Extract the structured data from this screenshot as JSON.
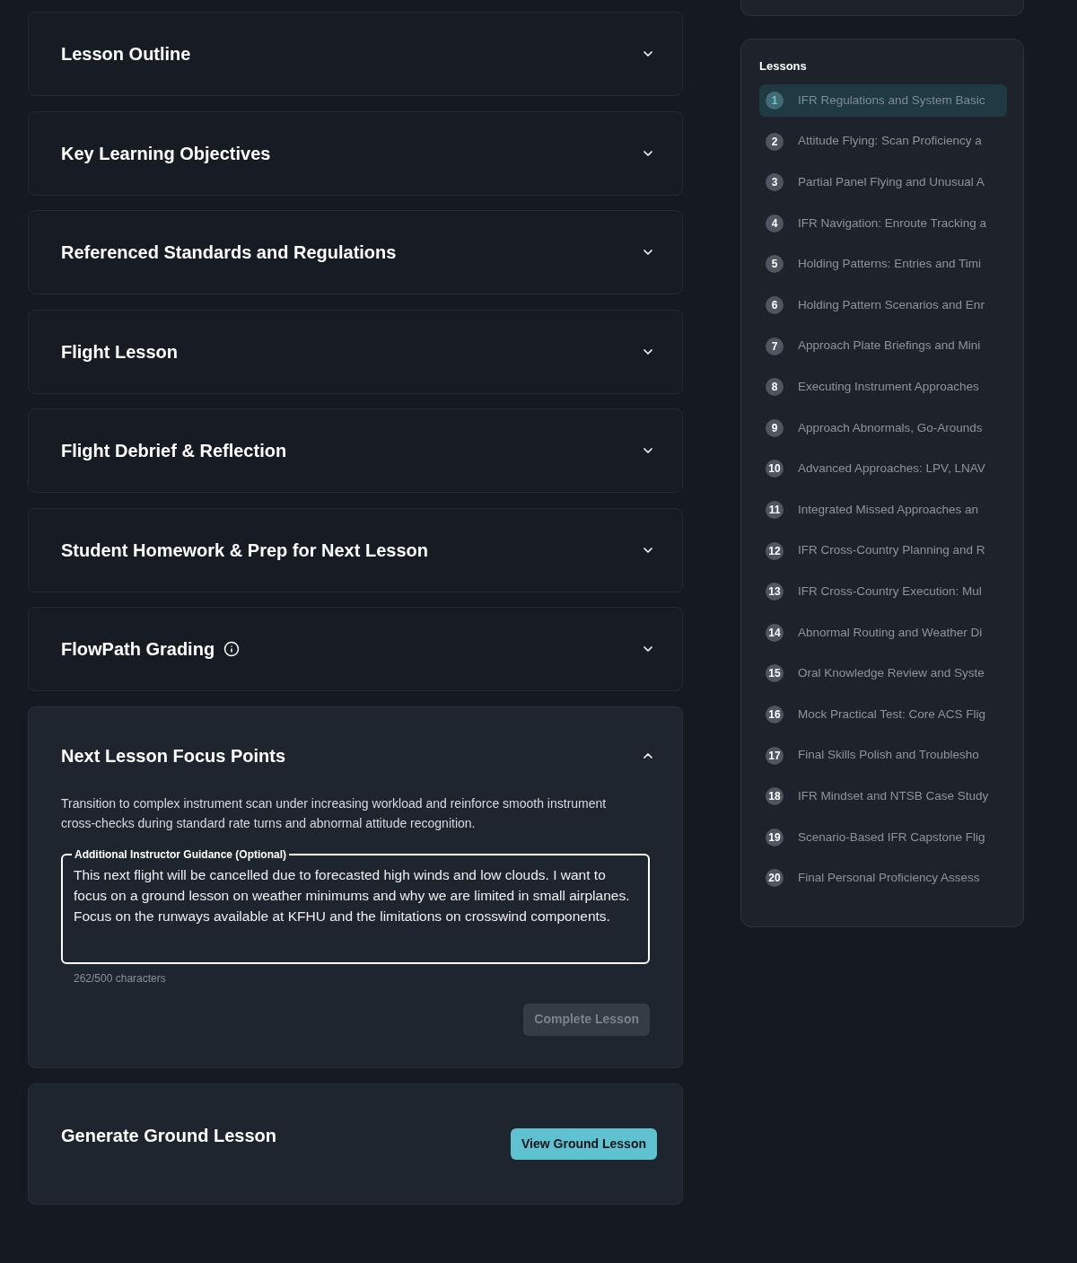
{
  "sections": [
    {
      "title": "Lesson Outline",
      "expanded": false
    },
    {
      "title": "Key Learning Objectives",
      "expanded": false
    },
    {
      "title": "Referenced Standards and Regulations",
      "expanded": false
    },
    {
      "title": "Flight Lesson",
      "expanded": false
    },
    {
      "title": "Flight Debrief & Reflection",
      "expanded": false
    },
    {
      "title": "Student Homework & Prep for Next Lesson",
      "expanded": false
    },
    {
      "title": "FlowPath Grading",
      "expanded": false,
      "info": true
    },
    {
      "title": "Next Lesson Focus Points",
      "expanded": true,
      "description": "Transition to complex instrument scan under increasing workload and reinforce smooth instrument cross-checks during standard rate turns and abnormal attitude recognition.",
      "guidance": {
        "label": "Additional Instructor Guidance (Optional)",
        "value": "This next flight will be cancelled due to forecasted high winds and low clouds. I want to focus on a ground lesson on weather minimums and why we are limited in small airplanes. Focus on the runways available at KFHU and the limitations on crosswind components.",
        "counter": "262/500 characters"
      },
      "button": {
        "label": "Complete Lesson",
        "disabled": true
      }
    }
  ],
  "ground_lesson": {
    "title": "Generate Ground Lesson",
    "button": "View Ground Lesson"
  },
  "lessons": {
    "title": "Lessons",
    "items": [
      {
        "number": "1",
        "title": "IFR Regulations and System Basic",
        "selected": true
      },
      {
        "number": "2",
        "title": "Attitude Flying: Scan Proficiency a",
        "selected": false
      },
      {
        "number": "3",
        "title": "Partial Panel Flying and Unusual A",
        "selected": false
      },
      {
        "number": "4",
        "title": "IFR Navigation: Enroute Tracking a",
        "selected": false
      },
      {
        "number": "5",
        "title": "Holding Patterns: Entries and Timi",
        "selected": false
      },
      {
        "number": "6",
        "title": "Holding Pattern Scenarios and Enr",
        "selected": false
      },
      {
        "number": "7",
        "title": "Approach Plate Briefings and Mini",
        "selected": false
      },
      {
        "number": "8",
        "title": "Executing Instrument Approaches",
        "selected": false
      },
      {
        "number": "9",
        "title": "Approach Abnormals, Go-Arounds",
        "selected": false
      },
      {
        "number": "10",
        "title": "Advanced Approaches: LPV, LNAV",
        "selected": false
      },
      {
        "number": "11",
        "title": "Integrated Missed Approaches an",
        "selected": false
      },
      {
        "number": "12",
        "title": "IFR Cross-Country Planning and R",
        "selected": false
      },
      {
        "number": "13",
        "title": "IFR Cross-Country Execution: Mul",
        "selected": false
      },
      {
        "number": "14",
        "title": "Abnormal Routing and Weather Di",
        "selected": false
      },
      {
        "number": "15",
        "title": "Oral Knowledge Review and Syste",
        "selected": false
      },
      {
        "number": "16",
        "title": "Mock Practical Test: Core ACS Flig",
        "selected": false
      },
      {
        "number": "17",
        "title": "Final Skills Polish and Troublesho",
        "selected": false
      },
      {
        "number": "18",
        "title": "IFR Mindset and NTSB Case Study",
        "selected": false
      },
      {
        "number": "19",
        "title": "Scenario-Based IFR Capstone Flig",
        "selected": false
      },
      {
        "number": "20",
        "title": "Final Personal Proficiency Assess",
        "selected": false
      }
    ]
  }
}
